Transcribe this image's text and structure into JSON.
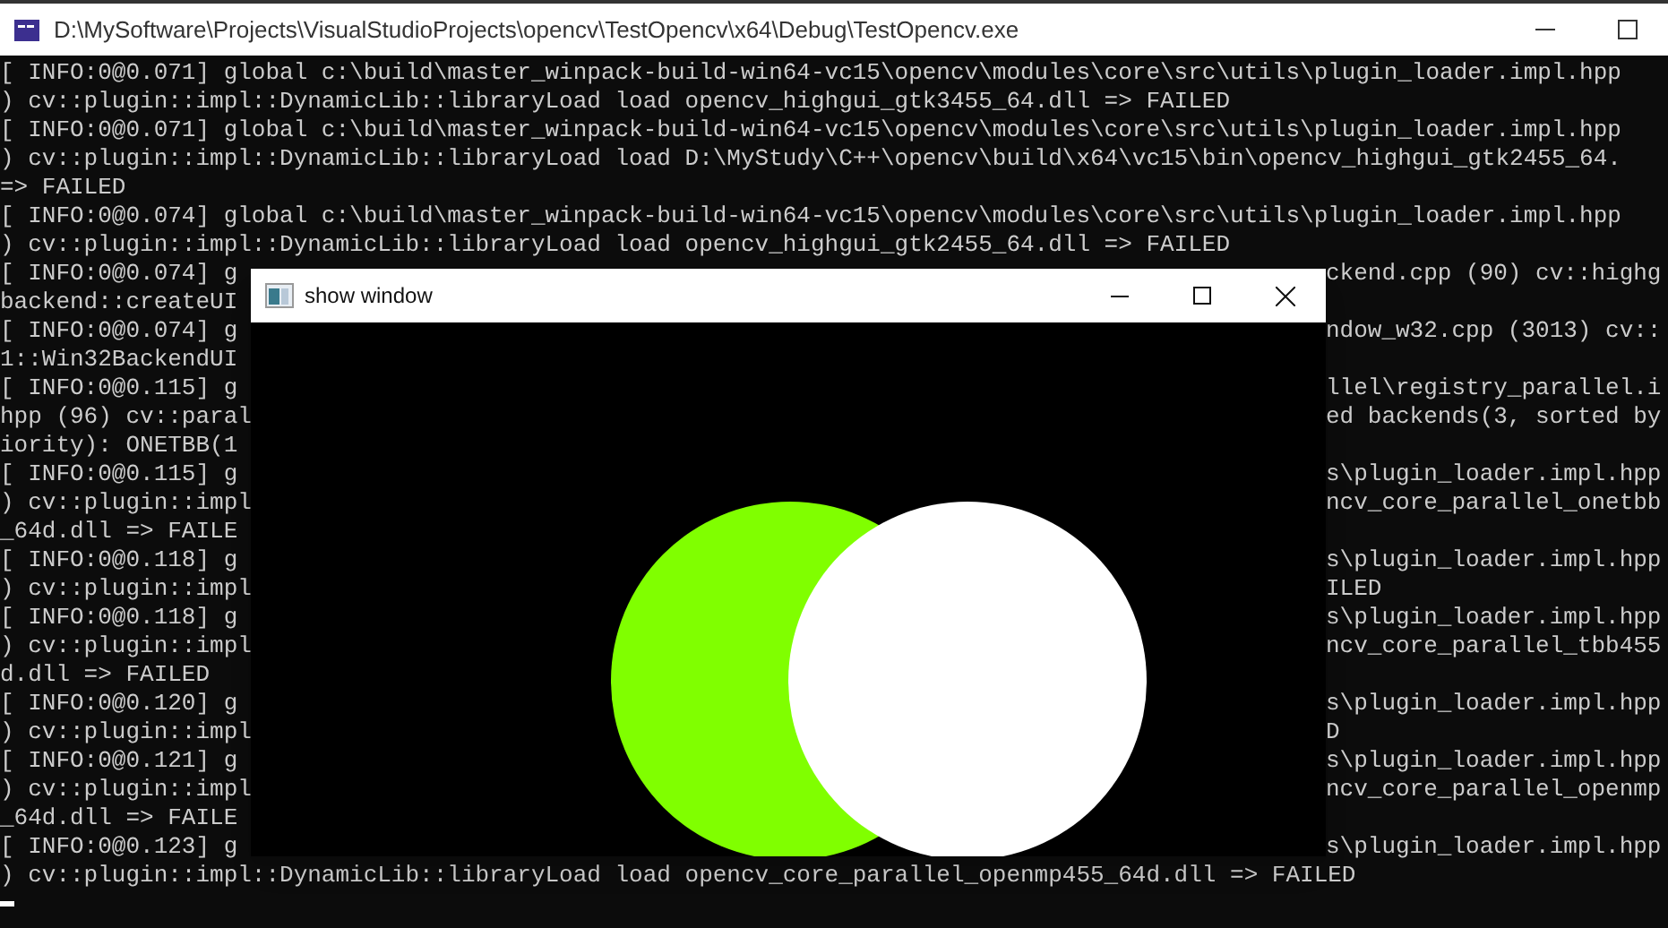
{
  "console": {
    "title": "D:\\MySoftware\\Projects\\VisualStudioProjects\\opencv\\TestOpencv\\x64\\Debug\\TestOpencv.exe",
    "lines": [
      {
        "kind": "full",
        "text": "[ INFO:0@0.071] global c:\\build\\master_winpack-build-win64-vc15\\opencv\\modules\\core\\src\\utils\\plugin_loader.impl.hpp"
      },
      {
        "kind": "full",
        "text": ") cv::plugin::impl::DynamicLib::libraryLoad load opencv_highgui_gtk3455_64.dll => FAILED"
      },
      {
        "kind": "full",
        "text": "[ INFO:0@0.071] global c:\\build\\master_winpack-build-win64-vc15\\opencv\\modules\\core\\src\\utils\\plugin_loader.impl.hpp"
      },
      {
        "kind": "full",
        "text": ") cv::plugin::impl::DynamicLib::libraryLoad load D:\\MyStudy\\C++\\opencv\\build\\x64\\vc15\\bin\\opencv_highgui_gtk2455_64."
      },
      {
        "kind": "full",
        "text": "=> FAILED"
      },
      {
        "kind": "full",
        "text": "[ INFO:0@0.074] global c:\\build\\master_winpack-build-win64-vc15\\opencv\\modules\\core\\src\\utils\\plugin_loader.impl.hpp"
      },
      {
        "kind": "full",
        "text": ") cv::plugin::impl::DynamicLib::libraryLoad load opencv_highgui_gtk2455_64.dll => FAILED"
      },
      {
        "kind": "split",
        "left": "[ INFO:0@0.074] g",
        "right": "ckend.cpp (90) cv::highg"
      },
      {
        "kind": "split",
        "left": "backend::createUI"
      },
      {
        "kind": "split",
        "left": "[ INFO:0@0.074] g",
        "right": "ndow_w32.cpp (3013) cv::"
      },
      {
        "kind": "split",
        "left": "1::Win32BackendUI"
      },
      {
        "kind": "split",
        "left": "[ INFO:0@0.115] g",
        "right": "llel\\registry_parallel.i"
      },
      {
        "kind": "split",
        "left": "hpp (96) cv::paral",
        "right": "ed backends(3, sorted by"
      },
      {
        "kind": "split",
        "left": "iority): ONETBB(1"
      },
      {
        "kind": "split",
        "left": "[ INFO:0@0.115] g",
        "right": "s\\plugin_loader.impl.hpp"
      },
      {
        "kind": "split",
        "left": ") cv::plugin::impl",
        "right": "ncv_core_parallel_onetbb"
      },
      {
        "kind": "split",
        "left": "_64d.dll => FAILE"
      },
      {
        "kind": "split",
        "left": "[ INFO:0@0.118] g",
        "right": "s\\plugin_loader.impl.hpp"
      },
      {
        "kind": "split",
        "left": ") cv::plugin::impl",
        "right": "ILED"
      },
      {
        "kind": "split",
        "left": "[ INFO:0@0.118] g",
        "right": "s\\plugin_loader.impl.hpp"
      },
      {
        "kind": "split",
        "left": ") cv::plugin::impl",
        "right": "ncv_core_parallel_tbb455"
      },
      {
        "kind": "split",
        "left": "d.dll => FAILED"
      },
      {
        "kind": "split",
        "left": "[ INFO:0@0.120] g",
        "right": "s\\plugin_loader.impl.hpp"
      },
      {
        "kind": "split",
        "left": ") cv::plugin::impl",
        "right": "D"
      },
      {
        "kind": "split",
        "left": "[ INFO:0@0.121] g",
        "right": "s\\plugin_loader.impl.hpp"
      },
      {
        "kind": "split",
        "left": ") cv::plugin::impl",
        "right": "ncv_core_parallel_openmp"
      },
      {
        "kind": "split",
        "left": "_64d.dll => FAILE"
      },
      {
        "kind": "split",
        "left": "[ INFO:0@0.123] g",
        "right": "s\\plugin_loader.impl.hpp"
      },
      {
        "kind": "full",
        "text": ") cv::plugin::impl::DynamicLib::libraryLoad load opencv_core_parallel_openmp455_64d.dll => FAILED"
      }
    ]
  },
  "image_window": {
    "title": "show window"
  }
}
